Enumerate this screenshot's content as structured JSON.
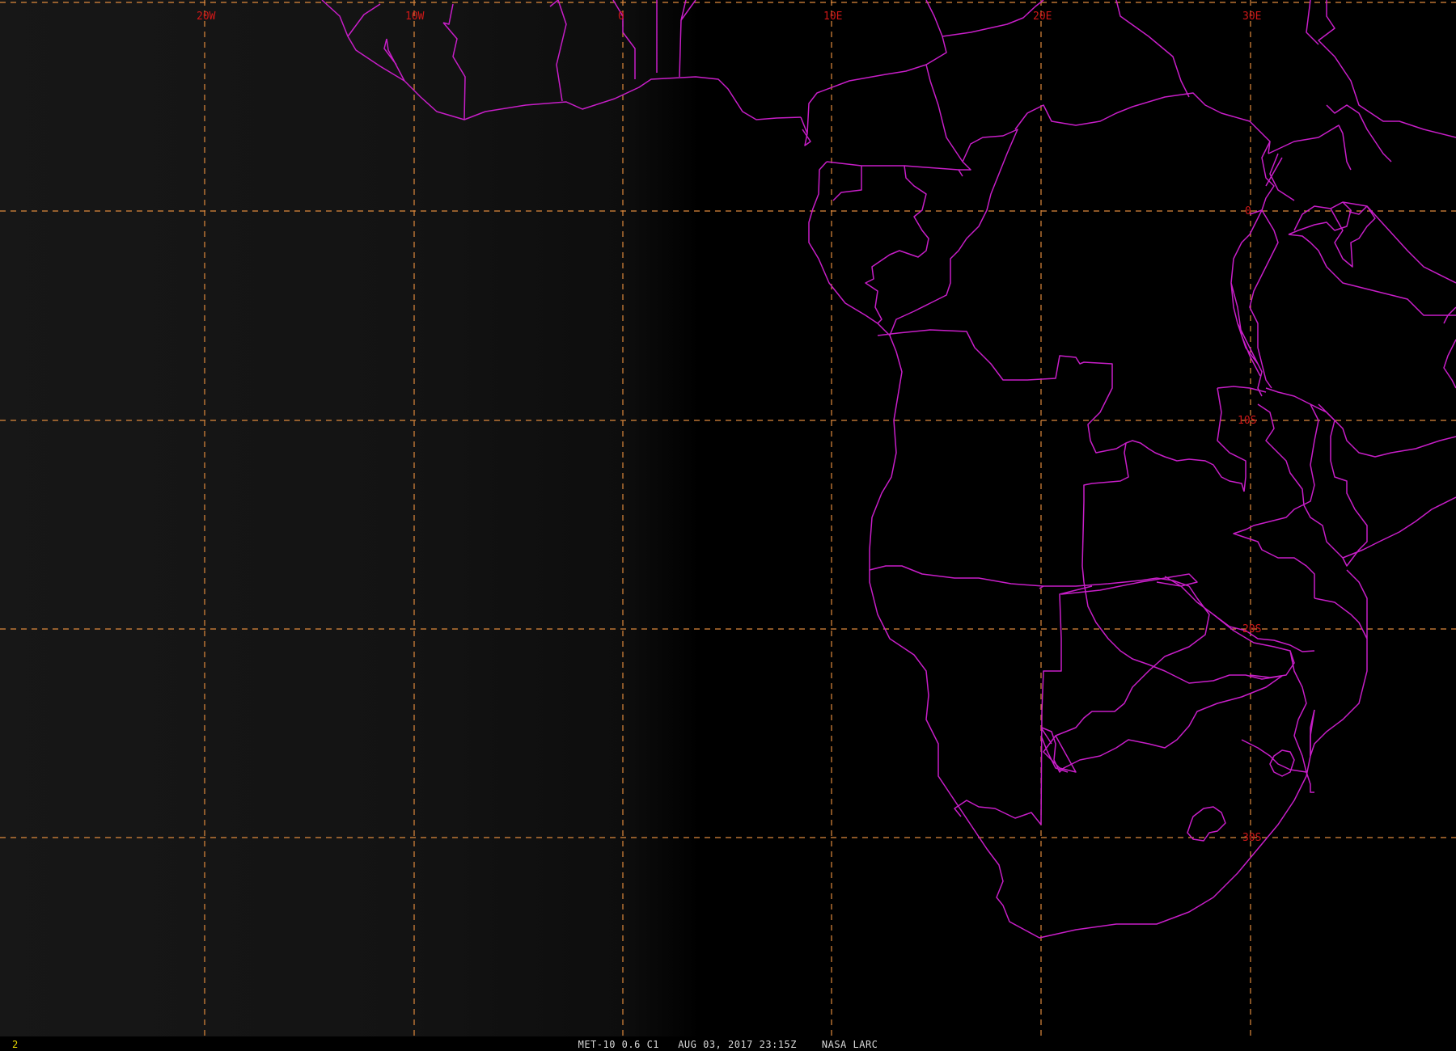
{
  "map": {
    "description_colors": {
      "background": "#000000",
      "ocean_haze": "#141414",
      "grid": "#e08a3c",
      "borders": "#c81ec8",
      "labels": "#d01818"
    },
    "longitude_labels": [
      "20W",
      "10W",
      "0",
      "10E",
      "20E",
      "30E"
    ],
    "latitude_labels": [
      "0",
      "10S",
      "20S",
      "30S"
    ]
  },
  "status_bar": {
    "frame_number": "2",
    "caption": "MET-10 0.6 C1   AUG 03, 2017 23:15Z    NASA LARC"
  }
}
